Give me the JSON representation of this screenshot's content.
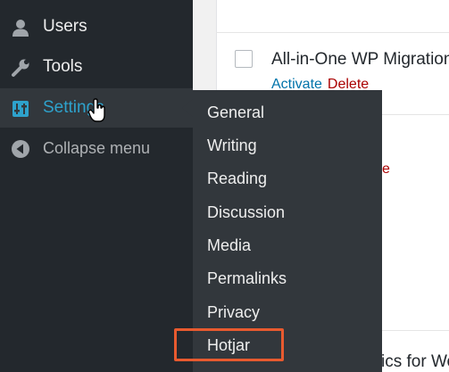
{
  "sidebar": {
    "items": [
      {
        "label": "Users",
        "icon": "user-icon"
      },
      {
        "label": "Tools",
        "icon": "wrench-icon"
      },
      {
        "label": "Settings",
        "icon": "settings-sliders-icon"
      },
      {
        "label": "Collapse menu",
        "icon": "collapse-arrow-icon"
      }
    ]
  },
  "settings_submenu": {
    "items": [
      "General",
      "Writing",
      "Reading",
      "Discussion",
      "Media",
      "Permalinks",
      "Privacy",
      "Hotjar"
    ],
    "highlighted_item": "Hotjar"
  },
  "plugins_list": {
    "row1": {
      "title": "All-in-One WP Migration",
      "activate_label": "Activate",
      "delete_label": "Delete"
    },
    "row2_fragment": "e",
    "row3_fragment": "ics for Wo"
  },
  "colors": {
    "sidebar_bg": "#23282d",
    "submenu_bg": "#32373c",
    "active_accent": "#2ea2cc",
    "link_blue": "#0073aa",
    "delete_red": "#a00",
    "highlight_border": "#e85a2f"
  }
}
